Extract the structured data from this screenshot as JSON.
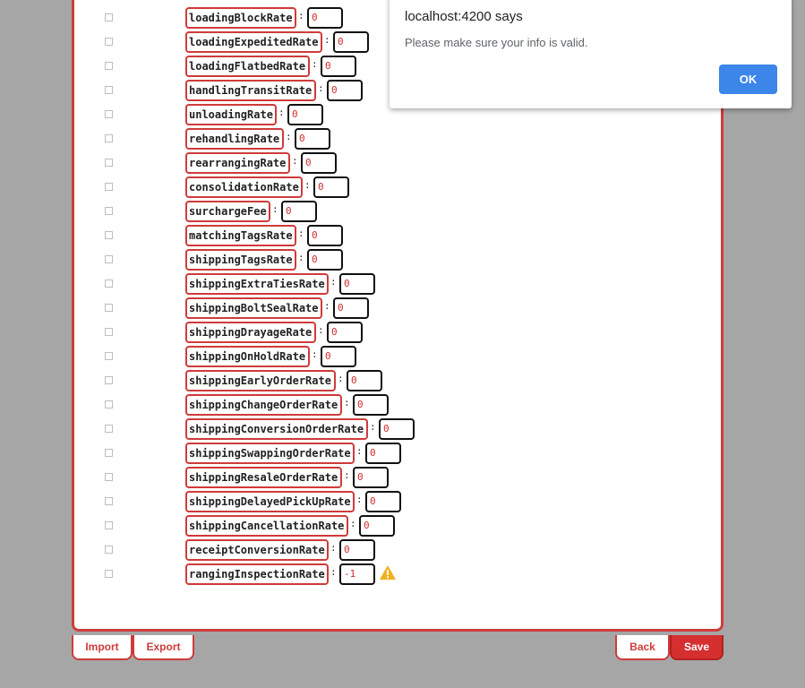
{
  "form": {
    "separator": ":",
    "fields": [
      {
        "key": "loadingBlockRate",
        "value": "0"
      },
      {
        "key": "loadingExpeditedRate",
        "value": "0"
      },
      {
        "key": "loadingFlatbedRate",
        "value": "0"
      },
      {
        "key": "handlingTransitRate",
        "value": "0"
      },
      {
        "key": "unloadingRate",
        "value": "0"
      },
      {
        "key": "rehandlingRate",
        "value": "0"
      },
      {
        "key": "rearrangingRate",
        "value": "0"
      },
      {
        "key": "consolidationRate",
        "value": "0"
      },
      {
        "key": "surchargeFee",
        "value": "0"
      },
      {
        "key": "matchingTagsRate",
        "value": "0"
      },
      {
        "key": "shippingTagsRate",
        "value": "0"
      },
      {
        "key": "shippingExtraTiesRate",
        "value": "0"
      },
      {
        "key": "shippingBoltSealRate",
        "value": "0"
      },
      {
        "key": "shippingDrayageRate",
        "value": "0"
      },
      {
        "key": "shippingOnHoldRate",
        "value": "0"
      },
      {
        "key": "shippingEarlyOrderRate",
        "value": "0"
      },
      {
        "key": "shippingChangeOrderRate",
        "value": "0"
      },
      {
        "key": "shippingConversionOrderRate",
        "value": "0"
      },
      {
        "key": "shippingSwappingOrderRate",
        "value": "0"
      },
      {
        "key": "shippingResaleOrderRate",
        "value": "0"
      },
      {
        "key": "shippingDelayedPickUpRate",
        "value": "0"
      },
      {
        "key": "shippingCancellationRate",
        "value": "0"
      },
      {
        "key": "receiptConversionRate",
        "value": "0"
      },
      {
        "key": "rangingInspectionRate",
        "value": "-1",
        "warning": true
      }
    ]
  },
  "dialog": {
    "title": "localhost:4200 says",
    "message": "Please make sure your info is valid.",
    "ok_label": "OK"
  },
  "footer": {
    "import_label": "Import",
    "export_label": "Export",
    "back_label": "Back",
    "save_label": "Save"
  },
  "colors": {
    "accent": "#cf3b3b",
    "save": "#d62f2f",
    "dialog_button": "#3b86e8",
    "warning": "#f2b01e"
  },
  "icons": {
    "warning": "warning-icon"
  }
}
